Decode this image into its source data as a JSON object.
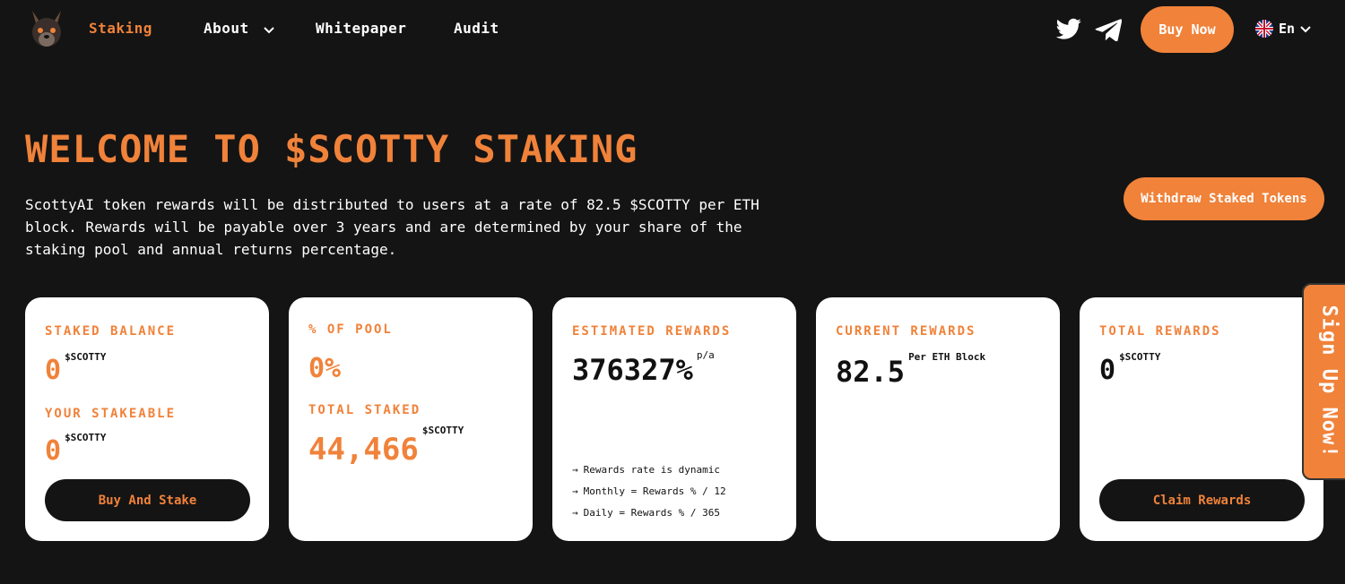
{
  "nav": {
    "links": [
      {
        "label": "Staking"
      },
      {
        "label": "About"
      },
      {
        "label": "Whitepaper"
      },
      {
        "label": "Audit"
      }
    ],
    "buy_now": "Buy Now",
    "language": "En"
  },
  "hero": {
    "title": "WELCOME TO $SCOTTY STAKING",
    "description": "ScottyAI token rewards will be distributed to users at a rate of 82.5 $SCOTTY per ETH block. Rewards will be payable over 3 years and are determined by your share of the staking pool and annual returns percentage.",
    "withdraw_button": "Withdraw Staked Tokens"
  },
  "cards": {
    "staked": {
      "label": "STAKED BALANCE",
      "value": "0",
      "unit": "$SCOTTY",
      "stakeable_label": "YOUR STAKEABLE",
      "stakeable_value": "0",
      "stakeable_unit": "$SCOTTY",
      "button": "Buy And Stake"
    },
    "pool": {
      "label": "% OF POOL",
      "value": "0%",
      "total_label": "TOTAL STAKED",
      "total_value": "44,466",
      "total_unit": "$SCOTTY"
    },
    "estimated": {
      "label": "ESTIMATED REWARDS",
      "value": "376327%",
      "unit": "p/a",
      "notes": [
        "Rewards rate is dynamic",
        "Monthly = Rewards % / 12",
        "Daily = Rewards % / 365"
      ]
    },
    "current": {
      "label": "CURRENT REWARDS",
      "value": "82.5",
      "unit": "Per ETH Block"
    },
    "total": {
      "label": "TOTAL REWARDS",
      "value": "0",
      "unit": "$SCOTTY",
      "button": "Claim Rewards"
    }
  },
  "signup_tab": "Sign Up Now!",
  "colors": {
    "background": "#141414",
    "accent": "#f0823a",
    "card": "#ffffff"
  },
  "icons": [
    "scotty-logo-icon",
    "chevron-down-icon",
    "twitter-icon",
    "telegram-icon",
    "uk-flag-icon",
    "arrow-right-icon"
  ]
}
